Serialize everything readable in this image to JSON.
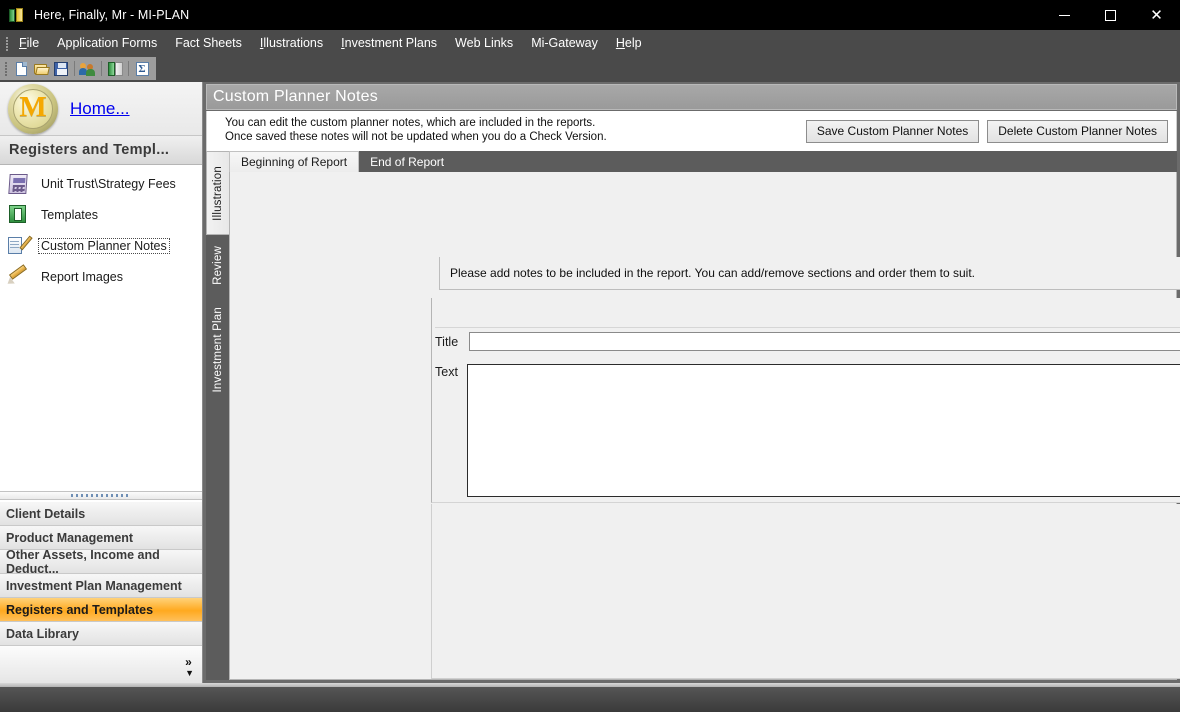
{
  "window": {
    "title": "Here, Finally, Mr - MI-PLAN",
    "icon": "books-icon",
    "controls": {
      "minimize": "–",
      "maximize": "□",
      "close": "✕"
    }
  },
  "menubar": {
    "items": [
      {
        "label": "File",
        "accel": "F"
      },
      {
        "label": "Application Forms",
        "accel": ""
      },
      {
        "label": "Fact Sheets",
        "accel": ""
      },
      {
        "label": "Illustrations",
        "accel": "I"
      },
      {
        "label": "Investment Plans",
        "accel": "I"
      },
      {
        "label": "Web Links",
        "accel": ""
      },
      {
        "label": "Mi-Gateway",
        "accel": ""
      },
      {
        "label": "Help",
        "accel": "H"
      }
    ]
  },
  "toolbar": {
    "buttons": [
      {
        "name": "new-document-icon"
      },
      {
        "name": "open-folder-icon"
      },
      {
        "name": "save-disk-icon"
      },
      {
        "name": "clients-people-icon"
      },
      {
        "name": "book-icon"
      },
      {
        "name": "sigma-icon",
        "glyph": "Σ"
      }
    ]
  },
  "sidebar": {
    "logo_letter": "M",
    "home_link": "Home...",
    "group_title": "Registers and Templ...",
    "items": [
      {
        "label": "Unit Trust\\Strategy Fees",
        "icon": "calculator-icon",
        "selected": false
      },
      {
        "label": "Templates",
        "icon": "green-book-icon",
        "selected": false
      },
      {
        "label": "Custom Planner Notes",
        "icon": "notepad-pencil-icon",
        "selected": true
      },
      {
        "label": "Report Images",
        "icon": "pencil-icon",
        "selected": false
      }
    ],
    "sections": [
      {
        "label": "Client Details",
        "active": false
      },
      {
        "label": "Product Management",
        "active": false
      },
      {
        "label": "Other Assets, Income and Deduct...",
        "active": false
      },
      {
        "label": "Investment Plan Management",
        "active": false
      },
      {
        "label": "Registers and Templates",
        "active": true
      },
      {
        "label": "Data Library",
        "active": false
      }
    ],
    "expand_chevron": "»"
  },
  "main": {
    "page_title": "Custom Planner Notes",
    "description_line1": "You can edit the custom planner notes, which are included in the reports.",
    "description_line2": "Once saved these notes will not be updated when you do a Check Version.",
    "save_button": "Save Custom Planner Notes",
    "delete_button": "Delete Custom Planner Notes",
    "vertical_tabs": [
      {
        "label": "Illustration",
        "active": true
      },
      {
        "label": "Review",
        "active": false
      },
      {
        "label": "Investment Plan",
        "active": false
      }
    ],
    "horizontal_tabs": [
      {
        "label": "Beginning of Report",
        "active": true
      },
      {
        "label": "End of Report",
        "active": false
      }
    ],
    "info_text": "Please add notes to be included in the report. You can add/remove sections and order them to suit.",
    "add_section_icon": "add-plus-icon",
    "move_down_icon": "move-down-triangle-icon",
    "move_up_icon": "move-up-triangle-icon",
    "remove_section_icon": "remove-x-icon",
    "fields": {
      "title_label": "Title",
      "title_value": "",
      "text_label": "Text",
      "text_value": ""
    },
    "scroll_up_glyph": "▲",
    "scroll_down_glyph": "▼"
  },
  "colors": {
    "accent_orange": "#ffa91f",
    "titlebar_bg": "#000000",
    "menubar_bg": "#4a4a4a",
    "content_bg": "#6b6b6b",
    "panel_bg": "#f0f0f0",
    "link_blue": "#0000ee"
  }
}
